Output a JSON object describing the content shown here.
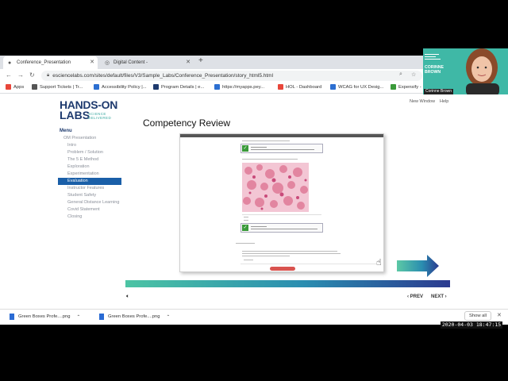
{
  "browser": {
    "tabs": [
      {
        "label": "Conference_Presentation",
        "active": true
      },
      {
        "label": "Digital Content -",
        "active": false
      }
    ],
    "url": "esciencelabs.com/sites/default/files/V3/Sample_Labs/Conference_Presentation/story_html5.html",
    "bookmarks": [
      {
        "label": "Apps",
        "color": "#e8463a"
      },
      {
        "label": "Support Tickets | Tr...",
        "color": "#555555"
      },
      {
        "label": "Accessibility Policy |...",
        "color": "#2c6fd1"
      },
      {
        "label": "Program Details | e...",
        "color": "#1e3a6e"
      },
      {
        "label": "https://myapps.pey...",
        "color": "#2c6fd1"
      },
      {
        "label": "HOL - Dashboard",
        "color": "#e8463a"
      },
      {
        "label": "WCAG for UX Desig...",
        "color": "#2c6fd1"
      },
      {
        "label": "Expensify -",
        "color": "#3a9a3a"
      }
    ]
  },
  "page": {
    "logo_line1": "HANDS-ON",
    "logo_line2": "LABS",
    "logo_tagline_1": "SCIENCE",
    "logo_tagline_2": "DELIVERED",
    "header_links": [
      "New Window",
      "Help"
    ],
    "menu_title": "Menu",
    "menu_items": [
      {
        "label": "OM Presentation",
        "level": "top"
      },
      {
        "label": "Intro",
        "level": "sub"
      },
      {
        "label": "Problem / Solution",
        "level": "sub"
      },
      {
        "label": "The 5 E Method",
        "level": "sub"
      },
      {
        "label": "Exploration",
        "level": "sub"
      },
      {
        "label": "Experimentation",
        "level": "sub"
      },
      {
        "label": "Evaluation",
        "level": "active"
      },
      {
        "label": "Instructor Features",
        "level": "sub"
      },
      {
        "label": "Student Safety",
        "level": "sub"
      },
      {
        "label": "General Distance Learning",
        "level": "sub"
      },
      {
        "label": "Covid Statement",
        "level": "sub"
      },
      {
        "label": "Closing",
        "level": "sub"
      }
    ],
    "slide_title": "Competency Review",
    "prev_label": "PREV",
    "next_label": "NEXT"
  },
  "downloads": {
    "items": [
      "Green Boxes Profe....png",
      "Green Boxes Profe....png"
    ],
    "show_all": "Show all"
  },
  "webcam": {
    "name_line1": "CORINNE",
    "name_line2": "BROWN",
    "label": "Corinne Brown"
  },
  "timestamp": "2020-04-03  18:47:15",
  "colors": {
    "brand_navy": "#1e3a6e",
    "menu_active": "#1a5fa8",
    "brand_teal": "#3aa8a0",
    "webcam_bg": "#3fb8a6"
  }
}
